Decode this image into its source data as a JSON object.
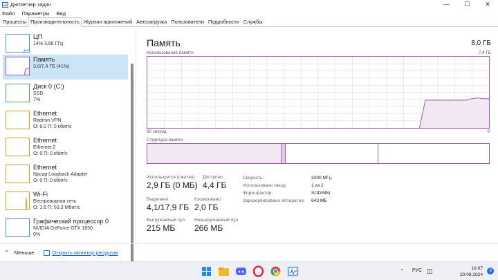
{
  "window": {
    "title": "Диспетчер задач",
    "controls": [
      "—",
      "☐",
      "✕"
    ]
  },
  "menu": [
    "Файл",
    "Параметры",
    "Вид"
  ],
  "tabs": [
    "Процессы",
    "Производительность",
    "Журнал приложений",
    "Автозагрузка",
    "Пользователи",
    "Подробности",
    "Службы"
  ],
  "active_tab": "Производительность",
  "sidebar": [
    {
      "title": "ЦП",
      "lines": [
        "14%  3,68 ГГц"
      ]
    },
    {
      "title": "Память",
      "lines": [
        "3,0/7,4 ГБ (41%)"
      ]
    },
    {
      "title": "Диск 0 (C:)",
      "lines": [
        "SSD",
        "7%"
      ]
    },
    {
      "title": "Ethernet",
      "lines": [
        "Radmin VPN",
        "О: 8,0  П: 0 кбит/с"
      ]
    },
    {
      "title": "Ethernet",
      "lines": [
        "Ethernet 2",
        "О: 0  П: 0 кбит/с"
      ]
    },
    {
      "title": "Ethernet",
      "lines": [
        "Npcap Loopback Adapter",
        "О: 0  П: 0 кбит/с"
      ]
    },
    {
      "title": "Wi-Fi",
      "lines": [
        "Беспроводная сеть",
        "О: 1,6  П: 53,3 Мбит/с"
      ]
    },
    {
      "title": "Графический процессор 0",
      "lines": [
        "NVIDIA GeForce GTX 1650",
        "0%"
      ]
    }
  ],
  "footer": {
    "less": "Меньше",
    "resource_monitor": "Открыть монитор ресурсов"
  },
  "main": {
    "title": "Память",
    "total": "8,0 ГБ",
    "graph_label": "Использование памяти",
    "graph_max": "7,4 ГБ",
    "graph_x_left": "60 секунд",
    "graph_x_right": "0",
    "structure_label": "Структура памяти",
    "stats": {
      "in_use_label": "Используется (сжатая)",
      "in_use_value": "2,9 ГБ (0 МБ)",
      "available_label": "Доступно",
      "available_value": "4,4 ГБ",
      "committed_label": "Выделено",
      "committed_value": "4,1/17,9 ГБ",
      "cached_label": "Кэшировано",
      "cached_value": "2,0 ГБ",
      "paged_label": "Выгружаемый пул",
      "paged_value": "215 МБ",
      "nonpaged_label": "Невыгружаемый пул",
      "nonpaged_value": "266 МБ"
    },
    "details": [
      {
        "key": "Скорость:",
        "value": "3200 МГц"
      },
      {
        "key": "Использовано гнезд:",
        "value": "1 из 2"
      },
      {
        "key": "Форм-фактор:",
        "value": "SODIMM"
      },
      {
        "key": "Зарезервировано аппаратно:",
        "value": "643 МБ"
      }
    ]
  },
  "memory_usage_series": [
    0,
    0,
    0,
    0,
    0,
    0,
    0,
    0,
    0,
    0,
    0,
    0,
    0,
    0,
    0,
    0,
    0,
    0,
    0,
    0,
    0,
    0,
    0,
    0,
    0,
    0,
    0,
    0,
    0,
    0,
    0,
    0,
    0,
    0,
    0,
    0,
    0,
    0,
    0,
    0,
    0,
    0,
    0,
    0,
    0,
    0,
    0,
    0,
    0.39,
    0.39,
    0.39,
    0.39,
    0.39,
    0.39,
    0.39,
    0.39,
    0.41,
    0.42,
    0.41,
    0.41
  ],
  "memory_structure": {
    "in_use_gb": 2.9,
    "modified_gb": 0.1,
    "standby_gb": 2.0,
    "free_gb": 2.4
  },
  "taskbar": {
    "language": "РУС",
    "time": "16:07",
    "date": "20.08.2024",
    "notifications": "3"
  }
}
